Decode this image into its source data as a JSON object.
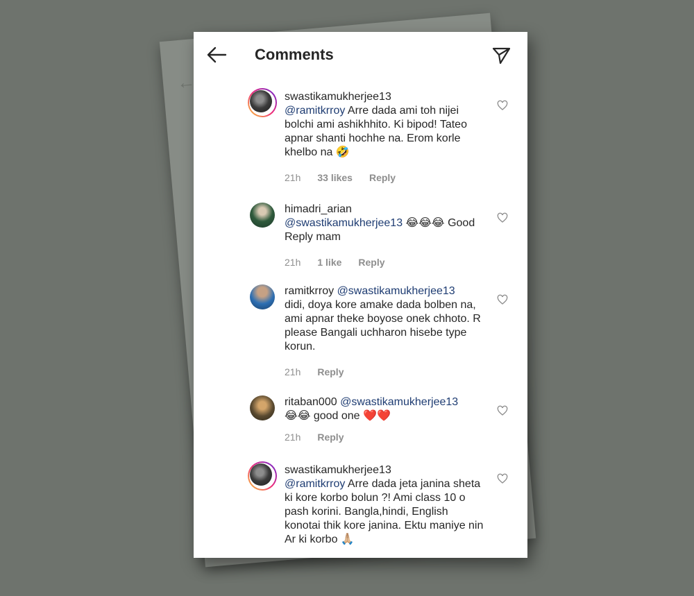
{
  "header": {
    "title": "Comments"
  },
  "comments": [
    {
      "username": "swastikamukherjee13",
      "mention": "@ramitkrroy",
      "text": " Arre dada ami toh nijei bolchi ami ashikhhito. Ki bipod! Tateo apnar shanti hochhe na. Erom korle khelbo na 🤣",
      "time": "21h",
      "likes": "33 likes",
      "reply": "Reply"
    },
    {
      "username": "himadri_arian",
      "mention": "@swastikamukherjee13",
      "text": " 😂😂😂 Good Reply mam",
      "time": "21h",
      "likes": "1 like",
      "reply": "Reply"
    },
    {
      "username": "ramitkrroy",
      "mention": "@swastikamukherjee13",
      "text": "didi, doya kore amake dada bolben na, ami apnar theke boyose onek chhoto. R please Bangali uchharon hisebe type korun.",
      "time": "21h",
      "reply": "Reply"
    },
    {
      "username": "ritaban000",
      "mention": "@swastikamukherjee13",
      "text": "😂😂 good one ❤️❤️",
      "time": "21h",
      "reply": "Reply"
    },
    {
      "username": "swastikamukherjee13",
      "mention": "@ramitkrroy",
      "text": " Arre dada jeta janina sheta ki kore korbo bolun ?! Ami class 10 o pash korini. Bangla,hindi, English konotai thik kore janina. Ektu maniye nin Ar ki korbo 🙏🏼"
    }
  ],
  "icons": {
    "back": "arrow-left-icon",
    "send": "paper-plane-icon",
    "like": "heart-outline-icon"
  },
  "colors": {
    "mention": "#1e3c72",
    "meta": "#8e8e8e",
    "background": "#6e736d"
  }
}
